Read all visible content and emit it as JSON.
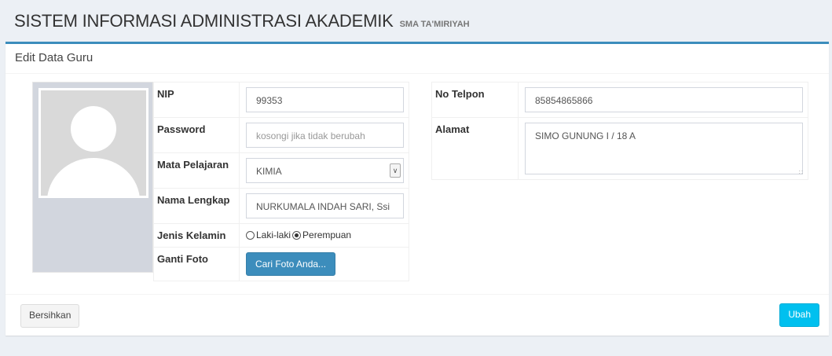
{
  "header": {
    "title": "SISTEM INFORMASI ADMINISTRASI AKADEMIK",
    "subtitle": "SMA TA'MIRIYAH"
  },
  "box": {
    "title": "Edit Data Guru"
  },
  "form": {
    "nip_label": "NIP",
    "nip_value": "99353",
    "password_label": "Password",
    "password_placeholder": "kosongi jika tidak berubah",
    "mapel_label": "Mata Pelajaran",
    "mapel_value": "KIMIA",
    "nama_label": "Nama Lengkap",
    "nama_value": "NURKUMALA INDAH SARI, Ssi",
    "jk_label": "Jenis Kelamin",
    "jk_options": [
      "Laki-laki",
      "Perempuan"
    ],
    "jk_selected": "Perempuan",
    "foto_label": "Ganti Foto",
    "foto_button": "Cari Foto Anda...",
    "telpon_label": "No Telpon",
    "telpon_value": "85854865866",
    "alamat_label": "Alamat",
    "alamat_value": "SIMO GUNUNG I / 18 A"
  },
  "footer": {
    "reset_label": "Bersihkan",
    "submit_label": "Ubah"
  },
  "colors": {
    "accent": "#3c8dbc",
    "info": "#00c0ef",
    "background": "#ecf0f5"
  }
}
